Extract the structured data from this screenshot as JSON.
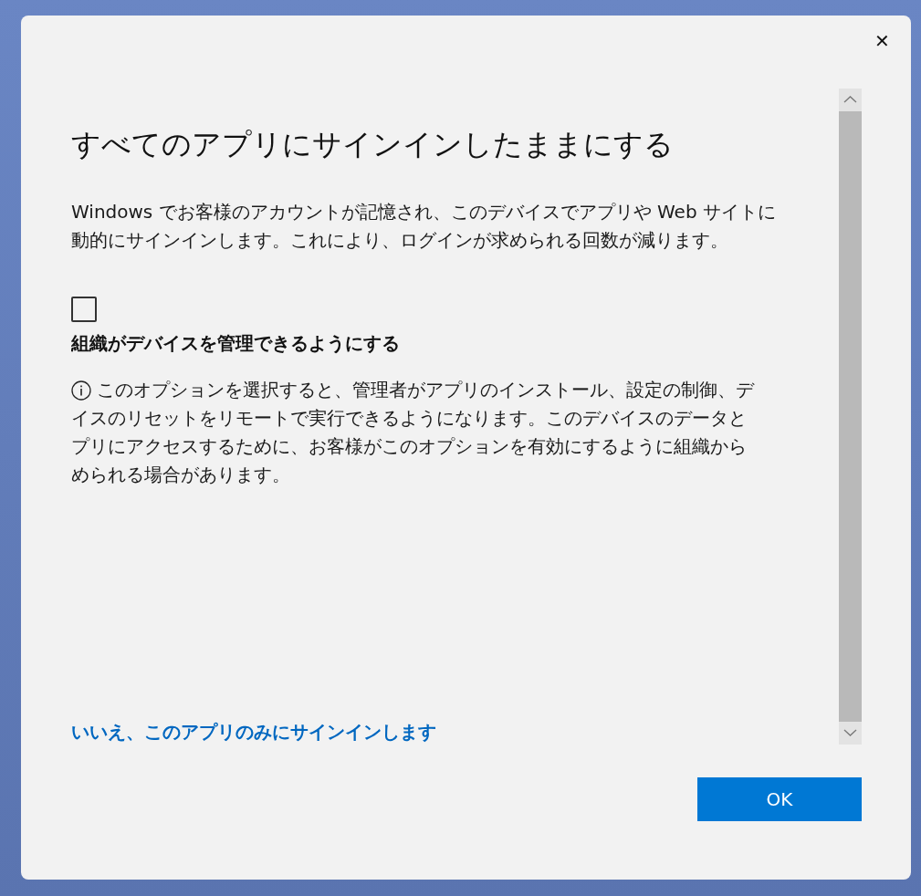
{
  "dialog": {
    "close_button": "✕",
    "title": "すべてのアプリにサインインしたままにする",
    "description_lines": [
      "Windows でお客様のアカウントが記憶され、このデバイスでアプリや Web サイトに",
      "動的にサインインします。これにより、ログインが求められる回数が減ります。"
    ],
    "checkbox": {
      "label": "組織がデバイスを管理できるようにする",
      "checked": false
    },
    "info_lines": [
      "このオプションを選択すると、管理者がアプリのインストール、設定の制御、デ",
      "イスのリセットをリモートで実行できるようになります。このデバイスのデータと",
      "プリにアクセスするために、お客様がこのオプションを有効にするように組織から",
      "められる場合があります。"
    ],
    "link": "いいえ、このアプリのみにサインインします",
    "ok_button": "OK"
  }
}
